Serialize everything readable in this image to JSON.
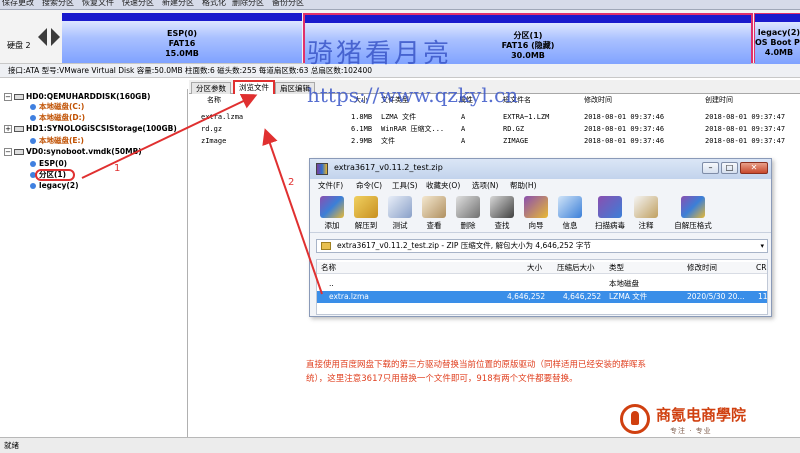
{
  "toolbar": {
    "items": [
      "保存更改",
      "搜索分区",
      "恢复文件",
      "快速分区",
      "新建分区",
      "格式化",
      "删除分区",
      "备份分区"
    ]
  },
  "disk": {
    "label": "硬盘 2",
    "partitions": [
      {
        "name": "ESP(0)",
        "fs": "FAT16",
        "size": "15.0MB"
      },
      {
        "name": "分区(1)",
        "fs": "FAT16 (隐藏)",
        "size": "30.0MB"
      },
      {
        "name": "legacy(2)",
        "fs": "OS Boot Par",
        "size": "4.0MB"
      }
    ],
    "info": "接口:ATA  型号:VMware Virtual Disk  容量:50.0MB  柱面数:6  磁头数:255  每道扇区数:63  总扇区数:102400"
  },
  "watermark": {
    "cn": "骑猪看月亮",
    "url": "https://www.qzkyl.cn"
  },
  "tree": {
    "items": [
      {
        "label": "HD0:QEMUHARDDISK(160GB)",
        "pm": "-",
        "kind": "disk"
      },
      {
        "label": "本地磁盘(C:)",
        "kind": "vol"
      },
      {
        "label": "本地磁盘(D:)",
        "kind": "vol"
      },
      {
        "label": "HD1:SYNOLOGiSCSIStorage(100GB)",
        "pm": "+",
        "kind": "disk"
      },
      {
        "label": "本地磁盘(E:)",
        "kind": "vol"
      },
      {
        "label": "VD0:synoboot.vmdk(50MB)",
        "pm": "-",
        "kind": "disk"
      },
      {
        "label": "ESP(0)",
        "kind": "part"
      },
      {
        "label": "分区(1)",
        "kind": "part"
      },
      {
        "label": "legacy(2)",
        "kind": "part"
      }
    ]
  },
  "tabs": [
    "分区参数",
    "浏览文件",
    "扇区编辑"
  ],
  "filelist": {
    "headers": [
      "名称",
      "大小",
      "文件类型",
      "属性",
      "短文件名",
      "修改时间",
      "创建时间"
    ],
    "rows": [
      [
        "extra.lzma",
        "1.8MB",
        "LZMA 文件",
        "A",
        "EXTRA~1.LZM",
        "2018-08-01 09:37:46",
        "2018-08-01 09:37:47"
      ],
      [
        "rd.gz",
        "6.1MB",
        "WinRAR 压缩文...",
        "A",
        "RD.GZ",
        "2018-08-01 09:37:46",
        "2018-08-01 09:37:47"
      ],
      [
        "zImage",
        "2.9MB",
        "文件",
        "A",
        "ZIMAGE",
        "2018-08-01 09:37:46",
        "2018-08-01 09:37:47"
      ]
    ]
  },
  "statusbar": {
    "text": "就绪"
  },
  "rar": {
    "title": "extra3617_v0.11.2_test.zip",
    "menu": [
      "文件(F)",
      "命令(C)",
      "工具(S)",
      "收藏夹(O)",
      "选项(N)",
      "帮助(H)"
    ],
    "tools": [
      "添加",
      "解压到",
      "测试",
      "查看",
      "删除",
      "查找",
      "向导",
      "信息",
      "扫描病毒",
      "注释",
      "自解压格式"
    ],
    "path": "extra3617_v0.11.2_test.zip - ZIP 压缩文件, 解包大小为 4,646,252 字节",
    "headers": [
      "名称",
      "大小",
      "压缩后大小",
      "类型",
      "修改时间",
      "CR"
    ],
    "rows": [
      [
        "..",
        "",
        "",
        "本地磁盘",
        "",
        ""
      ],
      [
        "extra.lzma",
        "4,646,252",
        "4,646,252",
        "LZMA 文件",
        "2020/5/30 20...",
        "11"
      ]
    ]
  },
  "annotation": {
    "text": "直接使用百度网盘下载的第三方驱动替换当前位置的原版驱动（同样适用已经安装的群晖系统），这里注意3617只用替换一个文件即可，918有两个文件都要替换。",
    "num1": "1",
    "num2": "2"
  },
  "logo": {
    "name": "商氪电商學院",
    "sub": "专注 · 专业"
  }
}
